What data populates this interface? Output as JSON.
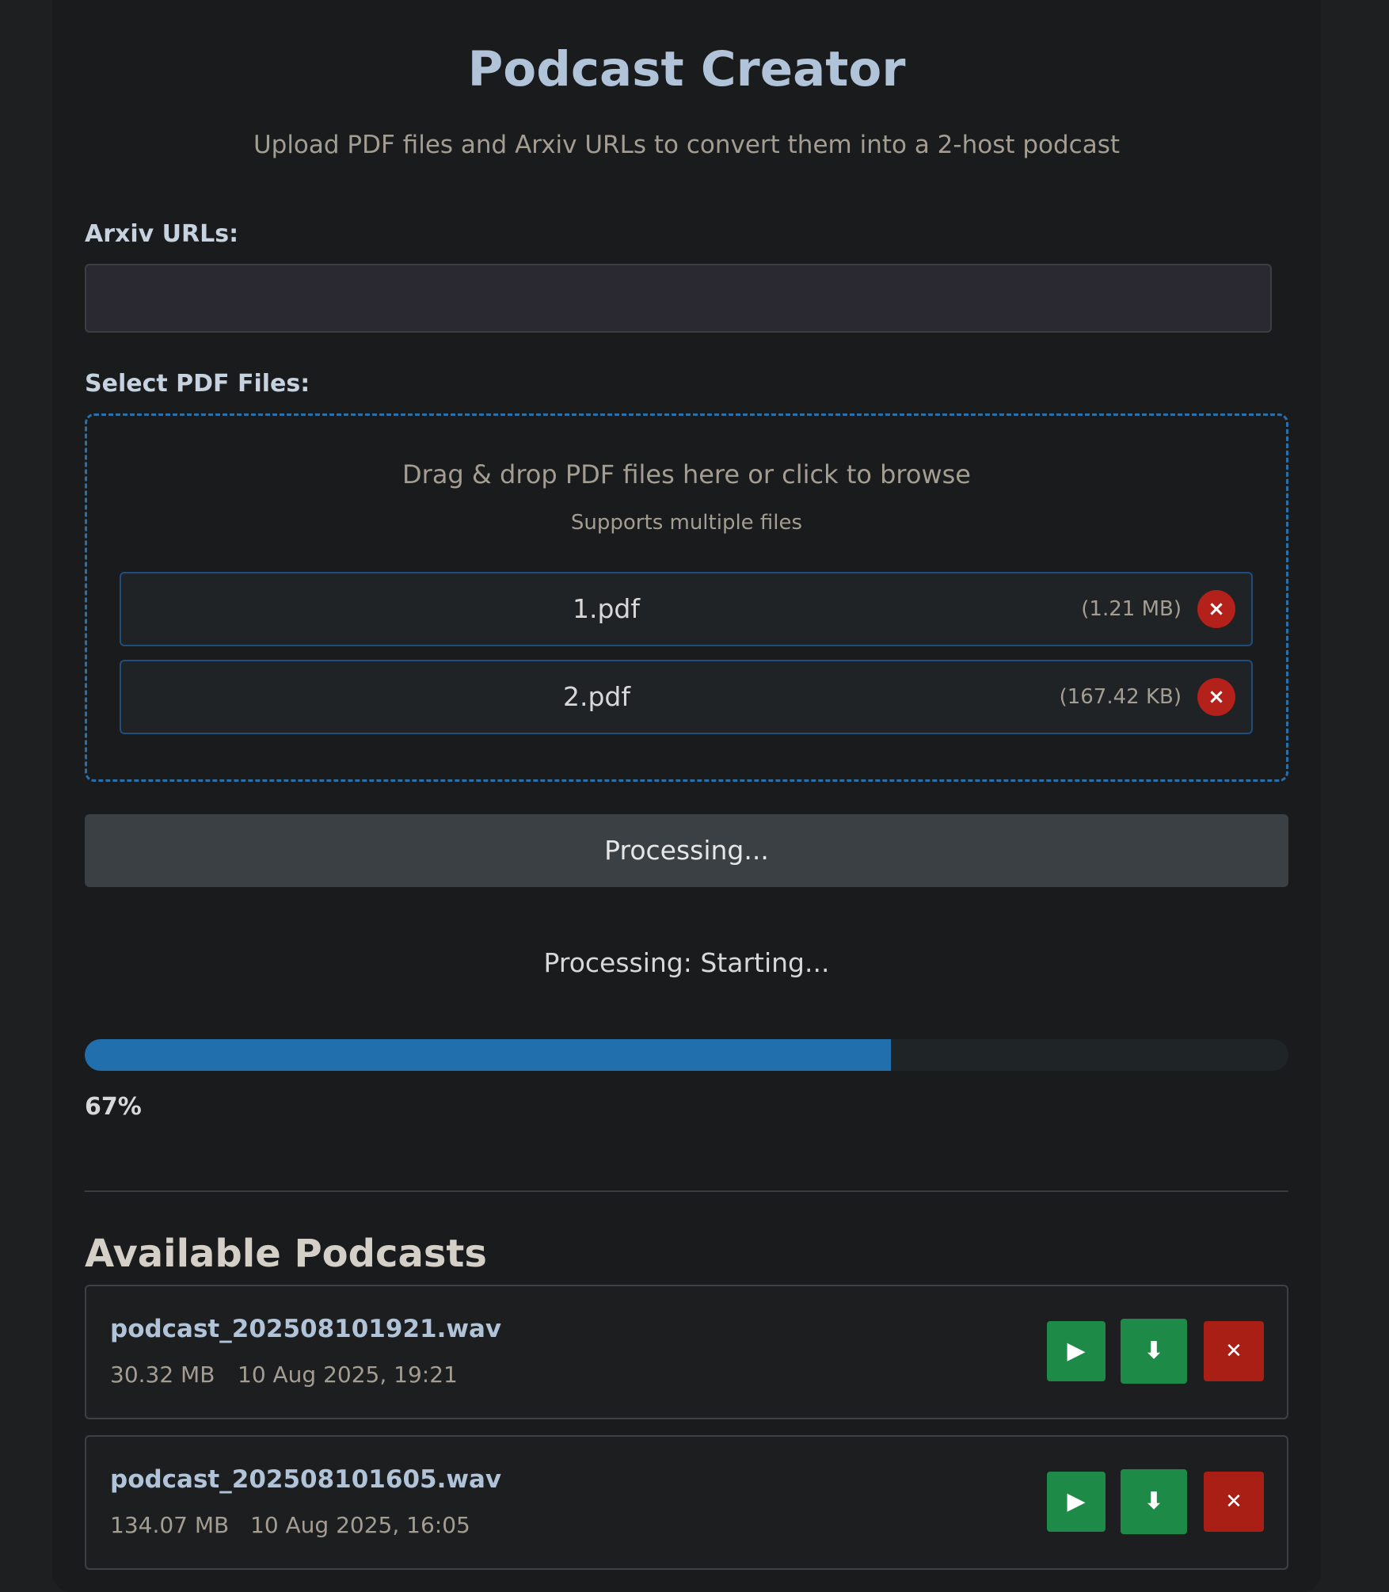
{
  "header": {
    "title": "Podcast Creator",
    "subtitle": "Upload PDF files and Arxiv URLs to convert them into a 2-host podcast"
  },
  "arxiv": {
    "label": "Arxiv URLs:",
    "value": "",
    "placeholder": ""
  },
  "pdf_select": {
    "label": "Select PDF Files:",
    "dropzone_text": "Drag & drop PDF files here or click to browse",
    "dropzone_subtext": "Supports multiple files",
    "files": [
      {
        "name": "1.pdf",
        "size": "(1.21 MB)",
        "remove_icon": "×"
      },
      {
        "name": "2.pdf",
        "size": "(167.42 KB)",
        "remove_icon": "×"
      }
    ]
  },
  "process_button": {
    "label": "Processing..."
  },
  "status": {
    "text": "Processing: Starting..."
  },
  "progress": {
    "percent": 67,
    "text": "67%",
    "fill_color": "#2170ad"
  },
  "podcasts": {
    "title": "Available Podcasts",
    "items": [
      {
        "name": "podcast_202508101921.wav",
        "size": "30.32 MB",
        "date": "10 Aug 2025, 19:21",
        "play_icon": "▶",
        "download_icon": "⬇",
        "delete_icon": "✕"
      },
      {
        "name": "podcast_202508101605.wav",
        "size": "134.07 MB",
        "date": "10 Aug 2025, 16:05",
        "play_icon": "▶",
        "download_icon": "⬇",
        "delete_icon": "✕"
      }
    ]
  },
  "colors": {
    "accent": "#2170ad",
    "success": "#1e8a48",
    "danger": "#a91e15",
    "title": "#b0c3d8"
  }
}
